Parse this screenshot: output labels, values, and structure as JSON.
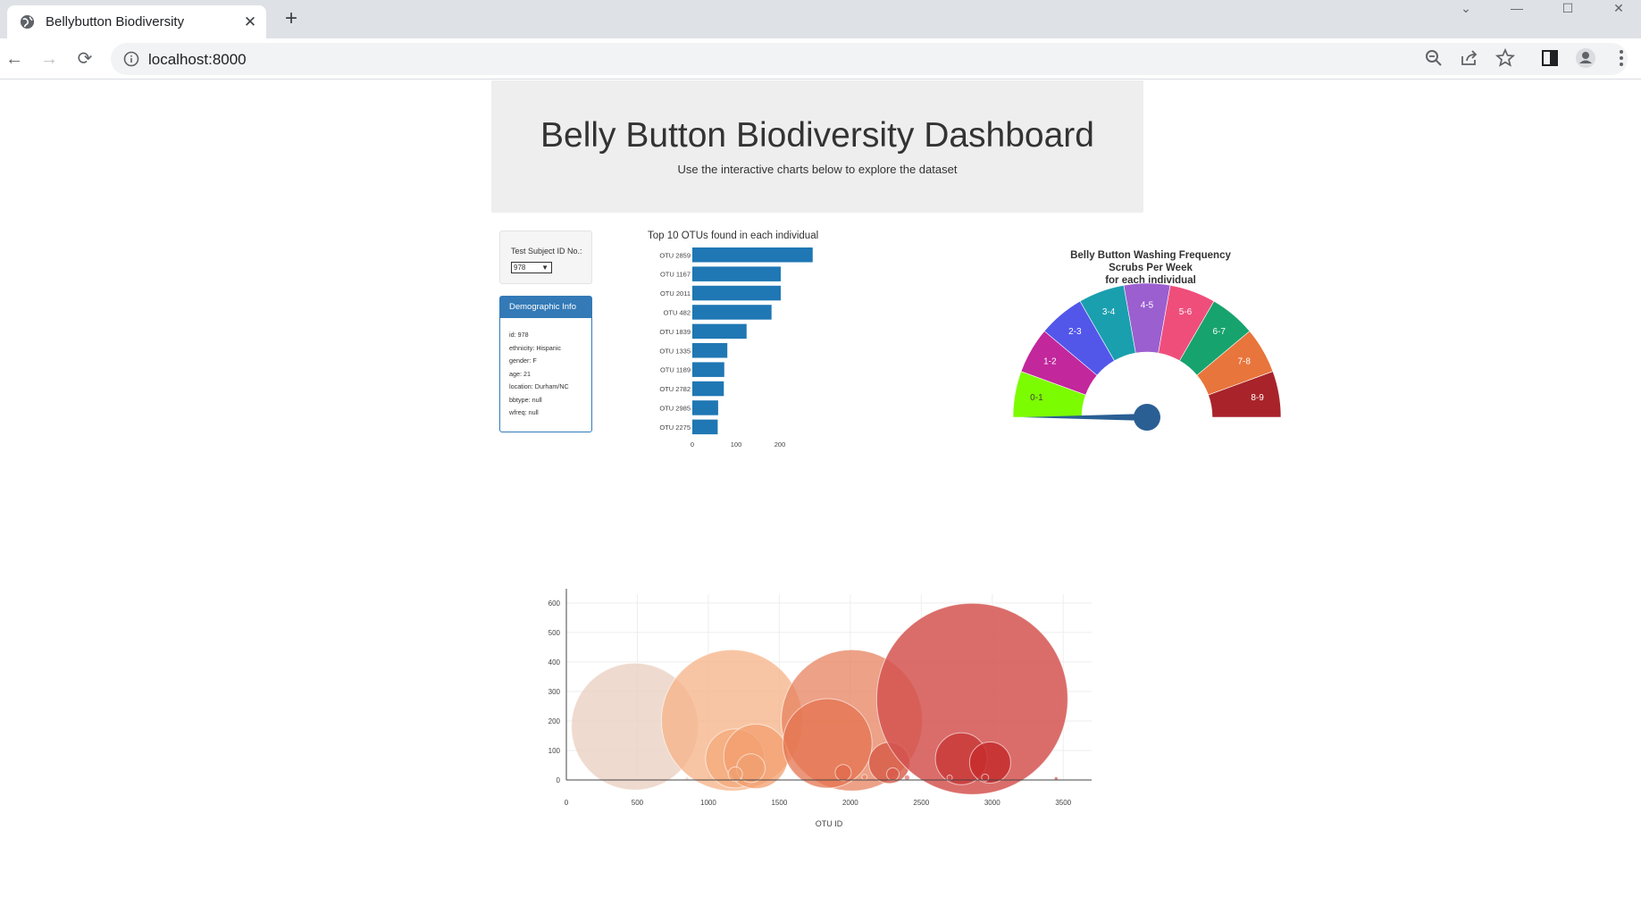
{
  "browser": {
    "tab_title": "Bellybutton Biodiversity",
    "url": "localhost:8000"
  },
  "header": {
    "title": "Belly Button Biodiversity Dashboard",
    "subtitle": "Use the interactive charts below to explore the dataset"
  },
  "selector": {
    "label": "Test Subject ID No.:",
    "selected": "978"
  },
  "demographics": {
    "heading": "Demographic Info",
    "lines": [
      "id: 978",
      "ethnicity: Hispanic",
      "gender: F",
      "age: 21",
      "location: Durham/NC",
      "bbtype: null",
      "wfreq: null"
    ]
  },
  "colors": {
    "bar": "#1f77b4",
    "panel_primary": "#337ab7",
    "needle": "#2a5f93"
  },
  "chart_data": [
    {
      "type": "bar",
      "orientation": "horizontal",
      "title": "Top 10 OTUs found in each individual",
      "categories": [
        "OTU 2859",
        "OTU 1167",
        "OTU 2011",
        "OTU 482",
        "OTU 1839",
        "OTU 1335",
        "OTU 1189",
        "OTU 2782",
        "OTU 2985",
        "OTU 2275"
      ],
      "values": [
        275,
        202,
        202,
        181,
        124,
        80,
        73,
        72,
        59,
        58
      ],
      "xticks": [
        "0",
        "100",
        "200"
      ],
      "xlim": [
        0,
        300
      ]
    },
    {
      "type": "gauge",
      "title_lines": [
        "Belly Button Washing Frequency",
        "Scrubs Per Week",
        "for each individual"
      ],
      "segments": [
        {
          "label": "0-1",
          "color": "#7cfc00"
        },
        {
          "label": "1-2",
          "color": "#c2279c"
        },
        {
          "label": "2-3",
          "color": "#5257ea"
        },
        {
          "label": "3-4",
          "color": "#1a9fae"
        },
        {
          "label": "4-5",
          "color": "#9b5fd0"
        },
        {
          "label": "5-6",
          "color": "#ef4e7b"
        },
        {
          "label": "6-7",
          "color": "#17a36d"
        },
        {
          "label": "7-8",
          "color": "#e8753c"
        },
        {
          "label": "8-9",
          "color": "#a8242a"
        }
      ],
      "value": 0
    },
    {
      "type": "scatter",
      "style": "bubble",
      "xlabel": "OTU ID",
      "xticks": [
        "0",
        "500",
        "1000",
        "1500",
        "2000",
        "2500",
        "3000",
        "3500"
      ],
      "yticks": [
        "0",
        "100",
        "200",
        "300",
        "400",
        "500",
        "600"
      ],
      "xlim": [
        0,
        3700
      ],
      "ylim": [
        0,
        630
      ],
      "points": [
        {
          "x": 482,
          "y": 181,
          "r": 71,
          "color": "#e9cdbf",
          "opacity": 0.75
        },
        {
          "x": 1167,
          "y": 202,
          "r": 79,
          "color": "#f5b285",
          "opacity": 0.75
        },
        {
          "x": 1189,
          "y": 73,
          "r": 33,
          "color": "#f4a87a",
          "opacity": 0.75
        },
        {
          "x": 1335,
          "y": 80,
          "r": 36,
          "color": "#f39e6e",
          "opacity": 0.75
        },
        {
          "x": 1300,
          "y": 40,
          "r": 16,
          "color": "#f0a070",
          "opacity": 0.7
        },
        {
          "x": 1190,
          "y": 20,
          "r": 8,
          "color": "#f0a070",
          "opacity": 0.7
        },
        {
          "x": 2011,
          "y": 202,
          "r": 79,
          "color": "#e7825f",
          "opacity": 0.75
        },
        {
          "x": 1839,
          "y": 124,
          "r": 50,
          "color": "#e4734f",
          "opacity": 0.75
        },
        {
          "x": 2275,
          "y": 58,
          "r": 23,
          "color": "#d65a45",
          "opacity": 0.8
        },
        {
          "x": 1950,
          "y": 25,
          "r": 9,
          "color": "#df6a4a",
          "opacity": 0.7
        },
        {
          "x": 2300,
          "y": 20,
          "r": 7,
          "color": "#d8584a",
          "opacity": 0.7
        },
        {
          "x": 2859,
          "y": 275,
          "r": 107,
          "color": "#d35350",
          "opacity": 0.85
        },
        {
          "x": 2782,
          "y": 72,
          "r": 29,
          "color": "#c83737",
          "opacity": 0.8
        },
        {
          "x": 2985,
          "y": 59,
          "r": 23,
          "color": "#c62d2d",
          "opacity": 0.85
        },
        {
          "x": 2400,
          "y": 8,
          "r": 3,
          "color": "#d35350",
          "opacity": 0.6
        },
        {
          "x": 2700,
          "y": 8,
          "r": 3,
          "color": "#d35350",
          "opacity": 0.6
        },
        {
          "x": 2950,
          "y": 8,
          "r": 4,
          "color": "#c83737",
          "opacity": 0.6
        },
        {
          "x": 3450,
          "y": 5,
          "r": 2,
          "color": "#c83737",
          "opacity": 0.6
        },
        {
          "x": 850,
          "y": 5,
          "r": 2,
          "color": "#e9cdbf",
          "opacity": 0.6
        },
        {
          "x": 2100,
          "y": 10,
          "r": 3,
          "color": "#e7825f",
          "opacity": 0.6
        }
      ]
    }
  ]
}
